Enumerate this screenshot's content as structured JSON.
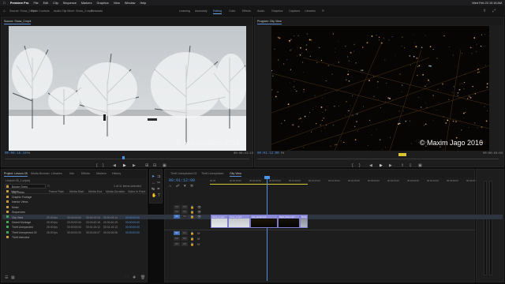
{
  "menubar": {
    "app": "Premiere Pro",
    "items": [
      "File",
      "Edit",
      "Clip",
      "Sequence",
      "Markers",
      "Graphics",
      "View",
      "Window",
      "Help"
    ],
    "clock": "Wed Feb 23  10:16 AM"
  },
  "workspace": {
    "home_icon": "home-icon",
    "open_tabs": [
      "Source: Snow_2.mp4",
      "Effect Controls",
      "Audio Clip Mixer: Snow_2.mp4",
      "Metadata"
    ],
    "tabs": [
      "Learning",
      "Assembly",
      "Editing",
      "Color",
      "Effects",
      "Audio",
      "Graphics",
      "Captions",
      "Libraries"
    ],
    "active": "Editing"
  },
  "source_monitor": {
    "tab": "Source: Snow_2.mp4",
    "timecode": "00:00:18:19",
    "fit": "Fit",
    "duration": "00:00:21:13",
    "copyright": "© Maxim Jago 2016"
  },
  "program_monitor": {
    "tab": "Program: City View",
    "timecode": "00:01:12:00",
    "fit": "Fit",
    "duration": "00:00:03:03",
    "copyright": "© Maxim Jago 2016"
  },
  "project": {
    "tabs": [
      "Project: Lesson 05",
      "Media Browser",
      "Libraries",
      "Info",
      "Effects",
      "Markers",
      "History"
    ],
    "active": "Project: Lesson 05",
    "path": "Lesson 05_1.prproj",
    "count": "1 of 11 items selected",
    "columns": [
      "Name",
      "Frame Rate",
      "Media Start",
      "Media End",
      "Media Duration",
      "Video In Point"
    ],
    "items": [
      {
        "name": "Boston Trees",
        "color": "#c69a3d",
        "fr": "",
        "start": "",
        "end": "",
        "dur": "",
        "vin": ""
      },
      {
        "name": "City Views",
        "color": "#c69a3d",
        "fr": "",
        "start": "",
        "end": "",
        "dur": "",
        "vin": ""
      },
      {
        "name": "Graphic Footage",
        "color": "#c69a3d",
        "fr": "",
        "start": "",
        "end": "",
        "dur": "",
        "vin": ""
      },
      {
        "name": "Interior Views",
        "color": "#c69a3d",
        "fr": "",
        "start": "",
        "end": "",
        "dur": "",
        "vin": ""
      },
      {
        "name": "Music",
        "color": "#c69a3d",
        "fr": "",
        "start": "",
        "end": "",
        "dur": "",
        "vin": ""
      },
      {
        "name": "Sequences",
        "color": "#c69a3d",
        "fr": "",
        "start": "",
        "end": "",
        "dur": "",
        "vin": ""
      },
      {
        "name": "City View",
        "color": "#3fa856",
        "fr": "25.00 fps",
        "start": "00:00:00:00",
        "end": "00:00:19:13",
        "dur": "00:00:19:14",
        "vin": "00:00:00:00",
        "sel": true
      },
      {
        "name": "Desert Montage",
        "color": "#3fa856",
        "fr": "25.00 fps",
        "start": "00:00:00:00",
        "end": "00:00:40:18",
        "dur": "00:00:40:19",
        "vin": "00:00:00:00"
      },
      {
        "name": "Theft Unexpected",
        "color": "#3fa856",
        "fr": "25.00 fps",
        "start": "00:00:00:00",
        "end": "00:01:16:12",
        "dur": "00:01:16:13",
        "vin": "00:00:00:00"
      },
      {
        "name": "Theft Unexpected 02",
        "color": "#3fa856",
        "fr": "25.00 fps",
        "start": "00:00:00:00",
        "end": "00:01:06:07",
        "dur": "00:01:06:08",
        "vin": "00:00:00:00"
      },
      {
        "name": "Theft Interview",
        "color": "#c69a3d",
        "fr": "",
        "start": "",
        "end": "",
        "dur": "",
        "vin": ""
      }
    ]
  },
  "timeline": {
    "tabs": [
      "Theft Unexpected 02",
      "Theft Unexpected",
      "City View"
    ],
    "active": "City View",
    "timecode": "00:01:12:00",
    "ruler": [
      "00:00",
      "00:00:15:00",
      "00:00:30:00",
      "00:00:45:00",
      "00:01:00:00",
      "00:01:15:00",
      "00:01:30:00",
      "00:01:45:00",
      "00:02:00:00",
      "00:02:15:00",
      "00:02:30:00",
      "00:02:45:00",
      "00:03:00:00",
      "00:03:15:00"
    ],
    "video_tracks": [
      "V3",
      "V2",
      "V1"
    ],
    "audio_tracks": [
      "A1",
      "A2",
      "A3"
    ],
    "clips": [
      {
        "name": "Snow_1.mp4",
        "thumb": "snow"
      },
      {
        "name": "Snow_2.mp4",
        "thumb": "snow2"
      },
      {
        "name": "City_Aerial.mp4",
        "thumb": "city"
      },
      {
        "name": "Night_Drive.mp4",
        "thumb": "night"
      },
      {
        "name": "Bridge.mp4",
        "thumb": "bridge"
      }
    ]
  },
  "colors": {
    "accent": "#4d93e4",
    "playhead": "#4d93e4",
    "clip": "#8b8bd8"
  }
}
